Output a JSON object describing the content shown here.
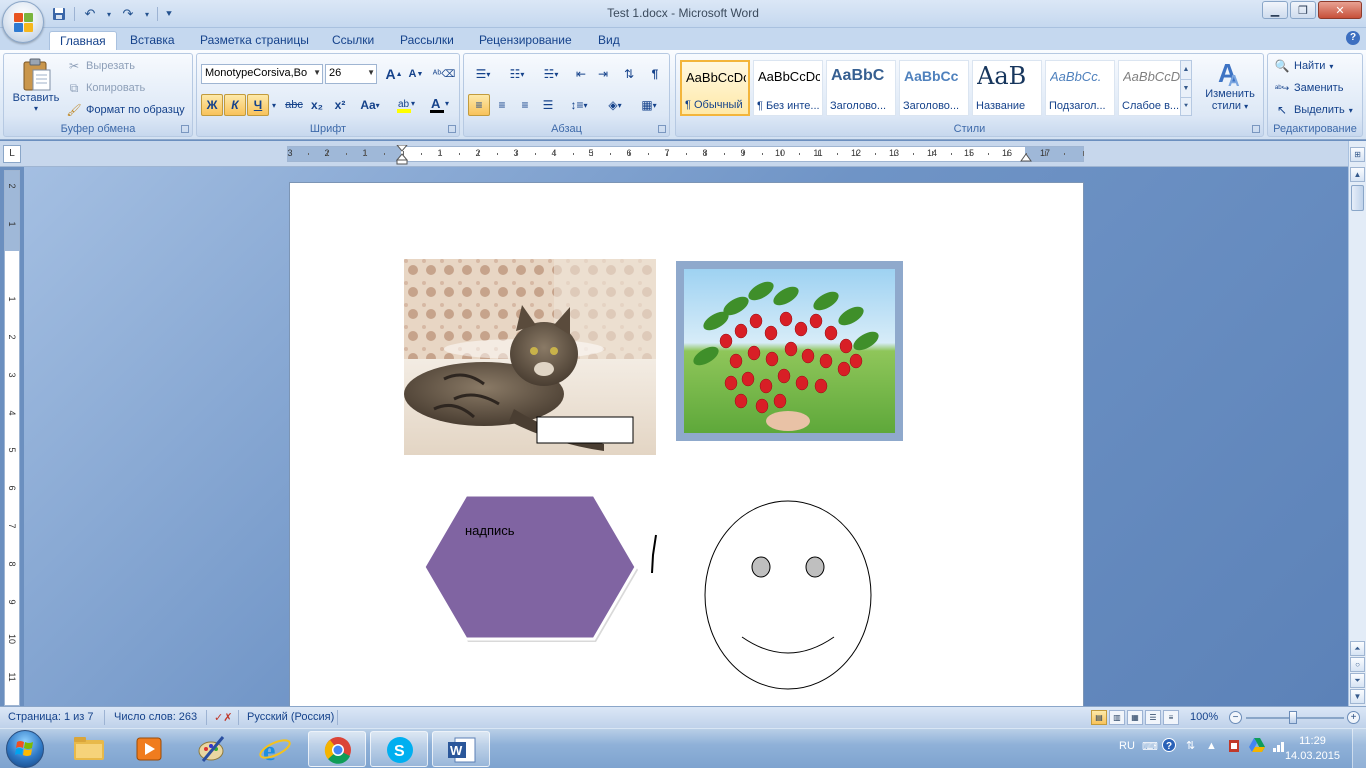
{
  "window": {
    "title": "Test 1.docx - Microsoft Word"
  },
  "qat": {
    "save": "save-icon",
    "undo": "undo-icon",
    "redo": "redo-icon"
  },
  "tabs": [
    {
      "label": "Главная",
      "active": true
    },
    {
      "label": "Вставка"
    },
    {
      "label": "Разметка страницы"
    },
    {
      "label": "Ссылки"
    },
    {
      "label": "Рассылки"
    },
    {
      "label": "Рецензирование"
    },
    {
      "label": "Вид"
    }
  ],
  "clipboard": {
    "group_label": "Буфер обмена",
    "paste": "Вставить",
    "cut": "Вырезать",
    "copy": "Копировать",
    "format_painter": "Формат по образцу"
  },
  "font": {
    "group_label": "Шрифт",
    "family": "MonotypeCorsiva,Bo",
    "size": "26",
    "bold": "Ж",
    "italic": "К",
    "underline": "Ч",
    "strike": "abc",
    "subscript": "x₂",
    "superscript": "x²",
    "case": "Aa",
    "grow": "A",
    "shrink": "A"
  },
  "paragraph": {
    "group_label": "Абзац"
  },
  "styles": {
    "group_label": "Стили",
    "items": [
      {
        "sample": "AaBbCcDc",
        "name": "¶ Обычный",
        "active": true
      },
      {
        "sample": "AaBbCcDc",
        "name": "¶ Без инте..."
      },
      {
        "sample": "AaBbC",
        "name": "Заголово..."
      },
      {
        "sample": "AaBbCc",
        "name": "Заголово..."
      },
      {
        "sample": "AaB",
        "name": "Название"
      },
      {
        "sample": "AaBbCc.",
        "name": "Подзагол..."
      },
      {
        "sample": "AaBbCcDc",
        "name": "Слабое в..."
      }
    ],
    "change_line1": "Изменить",
    "change_line2": "стили"
  },
  "editing": {
    "group_label": "Редактирование",
    "find": "Найти",
    "replace": "Заменить",
    "select": "Выделить"
  },
  "ruler": {
    "h_left": [
      "3",
      "2",
      "1"
    ],
    "h_right": [
      "1",
      "2",
      "3",
      "4",
      "5",
      "6",
      "7",
      "8",
      "9",
      "10",
      "11",
      "12",
      "13",
      "14",
      "15",
      "16",
      "17"
    ],
    "v": [
      "2",
      "1",
      "1",
      "2",
      "3",
      "4",
      "5",
      "6",
      "7",
      "8",
      "9",
      "10",
      "11"
    ]
  },
  "document": {
    "hexagon_text": "надпись",
    "hexagon_color": "#8064a2"
  },
  "status": {
    "page": "Страница: 1 из 7",
    "words": "Число слов: 263",
    "language": "Русский (Россия)",
    "zoom": "100%"
  },
  "taskbar": {
    "lang": "RU",
    "time": "11:29",
    "date": "14.03.2015"
  }
}
